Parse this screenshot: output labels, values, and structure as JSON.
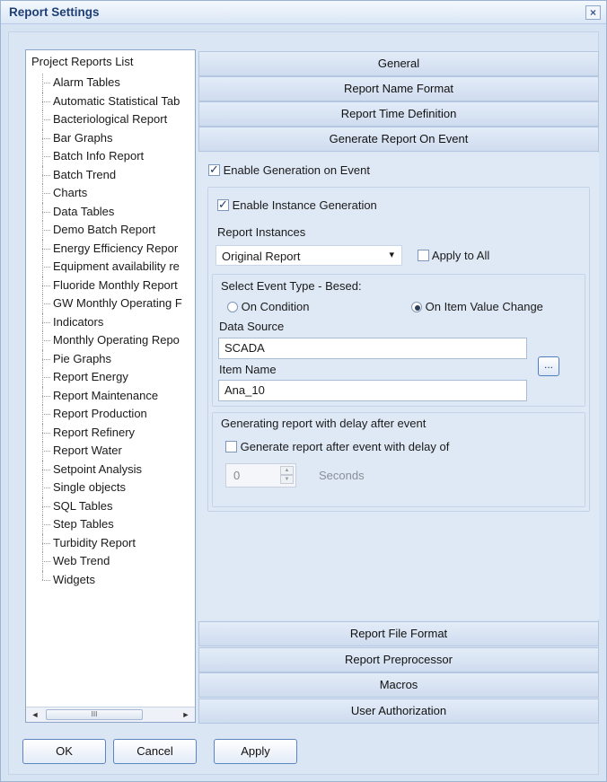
{
  "window": {
    "title": "Report Settings",
    "close_glyph": "×"
  },
  "tree": {
    "root": "Project Reports List",
    "items": [
      "Alarm Tables",
      "Automatic Statistical Tab",
      "Bacteriological Report",
      "Bar Graphs",
      "Batch Info Report",
      "Batch Trend",
      "Charts",
      "Data Tables",
      "Demo Batch Report",
      "Energy Efficiency Repor",
      "Equipment availability re",
      "Fluoride Monthly Report",
      "GW Monthly Operating F",
      "Indicators",
      "Monthly Operating Repo",
      "Pie Graphs",
      "Report Energy",
      "Report Maintenance",
      "Report Production",
      "Report Refinery",
      "Report Water",
      "Setpoint Analysis",
      "Single objects",
      "SQL Tables",
      "Step Tables",
      "Turbidity Report",
      "Web Trend",
      "Widgets"
    ],
    "scroll_left": "◄",
    "scroll_right": "►",
    "scroll_thumb_grip": "III"
  },
  "sections": {
    "general": "General",
    "report_name_format": "Report Name Format",
    "report_time_definition": "Report Time Definition",
    "generate_on_event": "Generate Report On Event",
    "report_file_format": "Report File Format",
    "report_preprocessor": "Report Preprocessor",
    "macros": "Macros",
    "user_authorization": "User Authorization"
  },
  "event": {
    "enable_generation_label": "Enable Generation on Event",
    "enable_generation_checked": true,
    "enable_instance_label": "Enable Instance Generation",
    "enable_instance_checked": true,
    "report_instances_label": "Report Instances",
    "report_instances_value": "Original Report",
    "dropdown_glyph": "▾",
    "apply_to_all_label": "Apply to All",
    "apply_to_all_checked": false,
    "event_type_label": "Select Event Type - Besed:",
    "on_condition_label": "On Condition",
    "on_item_value_change_label": "On Item Value Change",
    "selected_event_type": "On Item Value Change",
    "data_source_label": "Data Source",
    "data_source_value": "SCADA",
    "item_name_label": "Item Name",
    "item_name_value": "Ana_10",
    "browse_label": "...",
    "delay_group_label": "Generating report with delay after event",
    "delay_checkbox_label": "Generate report after event with delay of",
    "delay_checked": false,
    "delay_value": "0",
    "delay_unit": "Seconds",
    "spin_up": "▲",
    "spin_down": "▼"
  },
  "buttons": {
    "ok": "OK",
    "cancel": "Cancel",
    "apply": "Apply"
  }
}
